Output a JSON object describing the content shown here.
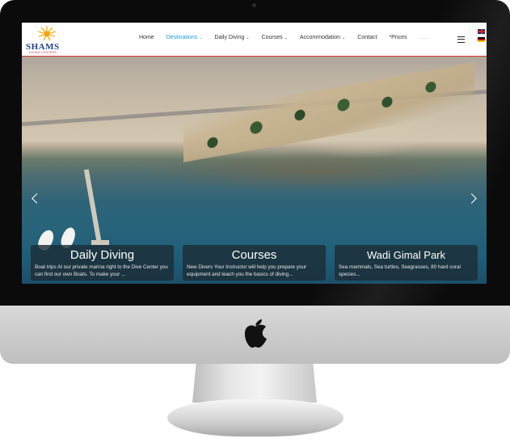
{
  "nav": {
    "logo_text": "SHAMS",
    "logo_subtitle": "DIVING CENTERS",
    "items": [
      {
        "label": "Home",
        "active": false,
        "dropdown": false
      },
      {
        "label": "Destinations",
        "active": true,
        "dropdown": true
      },
      {
        "label": "Daily Diving",
        "active": false,
        "dropdown": true
      },
      {
        "label": "Courses",
        "active": false,
        "dropdown": true
      },
      {
        "label": "Accommodation",
        "active": false,
        "dropdown": true
      },
      {
        "label": "Contact",
        "active": false,
        "dropdown": false
      },
      {
        "label": "*Prices",
        "active": false,
        "dropdown": false
      }
    ],
    "search_placeholder": "......",
    "caret": "⌄",
    "languages": [
      "en-flag-icon",
      "de-flag-icon"
    ],
    "accent_color": "#1e9bd7"
  },
  "hero": {
    "prev_icon": "chevron-left-icon",
    "next_icon": "chevron-right-icon",
    "cards": [
      {
        "title": "Daily Diving",
        "description": "Boat trips At our private marina right to the Dive Center you can find our own Boats. To make your ..."
      },
      {
        "title": "Courses",
        "description": "New Divers Your Instructor will help you prepare your equipment and teach you the basics of diving..."
      },
      {
        "title": "Wadi Gimal Park",
        "description": "Sea mammals, Sea turtles, Seagrasses, 80 hard coral species..."
      }
    ]
  },
  "device": {
    "logo_icon": "apple-logo-icon"
  }
}
